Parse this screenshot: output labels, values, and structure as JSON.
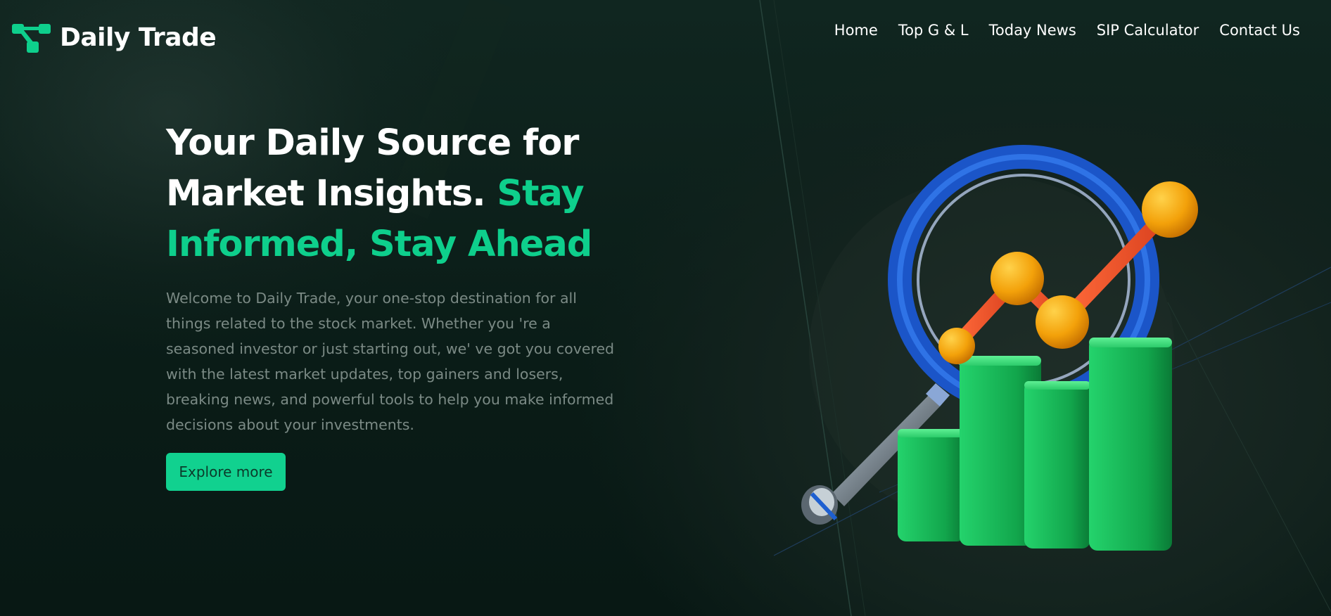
{
  "brand": {
    "name": "Daily Trade",
    "logo_icon": "connected-nodes-icon",
    "accent_color": "#0ecf8c"
  },
  "nav": {
    "items": [
      {
        "label": "Home"
      },
      {
        "label": "Top G & L"
      },
      {
        "label": "Today News"
      },
      {
        "label": "SIP Calculator"
      },
      {
        "label": "Contact Us"
      }
    ]
  },
  "hero": {
    "title_line1": "Your Daily Source for",
    "title_line2_white": "Market Insights.",
    "title_line2_accent": "Stay",
    "title_line3_accent": "Informed, Stay Ahead",
    "description": "Welcome to Daily Trade, your one-stop destination for all things related to the stock market. Whether you 're a seasoned investor or just starting out, we' ve got you covered with the latest market updates, top gainers and losers, breaking news, and powerful tools to help you make informed decisions about your investments.",
    "cta_label": "Explore more",
    "illustration": "magnifier-bar-chart-illustration"
  },
  "colors": {
    "background": "#0a1a16",
    "button": "#11d18f",
    "bars": "#1fbf5c",
    "magnifier": "#1e63d6",
    "points": "#f0a000",
    "line": "#e8522c"
  }
}
